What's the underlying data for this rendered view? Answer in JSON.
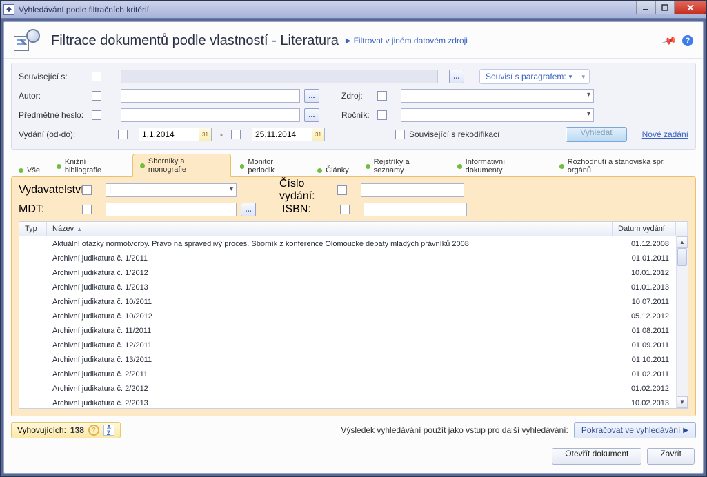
{
  "window_title": "Vyhledávání podle filtračních kritérií",
  "header": {
    "title": "Filtrace dokumentů podle vlastností - Literatura",
    "alt_link": "Filtrovat v jiném datovém zdroji"
  },
  "filters": {
    "souvisejici_label": "Související s:",
    "paragraf_label": "Souvisí s paragrafem:",
    "autor_label": "Autor:",
    "zdroj_label": "Zdroj:",
    "heslo_label": "Předmětné heslo:",
    "rocnik_label": "Ročník:",
    "vydani_label": "Vydání (od-do):",
    "date_from": "1.1.2014",
    "date_to": "25.11.2014",
    "rekod_label": "Související s rekodifikací",
    "search_btn": "Vyhledat",
    "new_link": "Nové zadání",
    "ellipsis": "..."
  },
  "tabs": [
    "Vše",
    "Knižní bibliografie",
    "Sborníky a monografie",
    "Monitor periodik",
    "Články",
    "Rejstříky a seznamy",
    "Informativní dokumenty",
    "Rozhodnutí a stanoviska spr. orgánů"
  ],
  "active_tab_index": 2,
  "subfilters": {
    "vydavatelstvi_label": "Vydavatelství:",
    "cislo_label": "Číslo vydání:",
    "mdt_label": "MDT:",
    "isbn_label": "ISBN:"
  },
  "grid": {
    "col_typ": "Typ",
    "col_nazev": "Název",
    "col_datum": "Datum vydání",
    "rows": [
      {
        "n": "Aktuální otázky normotvorby. Právo na spravedlivý proces. Sborník z konference Olomoucké debaty mladých právníků 2008",
        "d": "01.12.2008"
      },
      {
        "n": "Archivní judikatura č. 1/2011",
        "d": "01.01.2011"
      },
      {
        "n": "Archivní judikatura č. 1/2012",
        "d": "10.01.2012"
      },
      {
        "n": "Archivní judikatura č. 1/2013",
        "d": "01.01.2013"
      },
      {
        "n": "Archivní judikatura č. 10/2011",
        "d": "10.07.2011"
      },
      {
        "n": "Archivní judikatura č. 10/2012",
        "d": "05.12.2012"
      },
      {
        "n": "Archivní judikatura č. 11/2011",
        "d": "01.08.2011"
      },
      {
        "n": "Archivní judikatura č. 12/2011",
        "d": "01.09.2011"
      },
      {
        "n": "Archivní judikatura č. 13/2011",
        "d": "01.10.2011"
      },
      {
        "n": "Archivní judikatura č. 2/2011",
        "d": "01.02.2011"
      },
      {
        "n": "Archivní judikatura č. 2/2012",
        "d": "01.02.2012"
      },
      {
        "n": "Archivní judikatura č. 2/2013",
        "d": "10.02.2013"
      }
    ]
  },
  "status": {
    "label": "Vyhovujících:",
    "count": "138",
    "hint": "Výsledek vyhledávání použít jako vstup pro další vyhledávání:",
    "continue_btn": "Pokračovat ve vyhledávání"
  },
  "footer": {
    "open": "Otevřít dokument",
    "close": "Zavřít"
  }
}
